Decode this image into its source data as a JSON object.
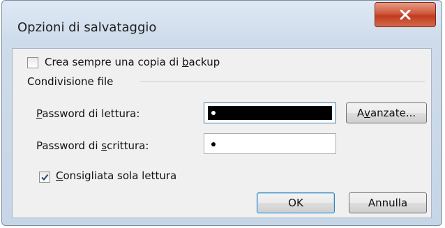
{
  "window": {
    "title": "Opzioni di salvataggio"
  },
  "backup": {
    "pre": "Crea sempre una copia di ",
    "hot": "b",
    "post": "ackup",
    "checked": false
  },
  "group": {
    "label": "Condivisione file"
  },
  "read_pw": {
    "hot": "P",
    "post": "assword di lettura:",
    "mask": "•"
  },
  "write_pw": {
    "pre": "Password di ",
    "hot": "s",
    "post": "crittura:",
    "mask": "•"
  },
  "readonly": {
    "hot": "C",
    "post": "onsigliata sola lettura",
    "checked": true,
    "check_mark": "✓"
  },
  "buttons": {
    "advanced": {
      "pre": "A",
      "hot": "v",
      "post": "anzate..."
    },
    "ok": "OK",
    "cancel": "Annulla"
  },
  "icons": {
    "close": "close-icon",
    "check": "checkmark-icon"
  },
  "colors": {
    "close_button": "#c94a2e",
    "selection": "#000000"
  }
}
